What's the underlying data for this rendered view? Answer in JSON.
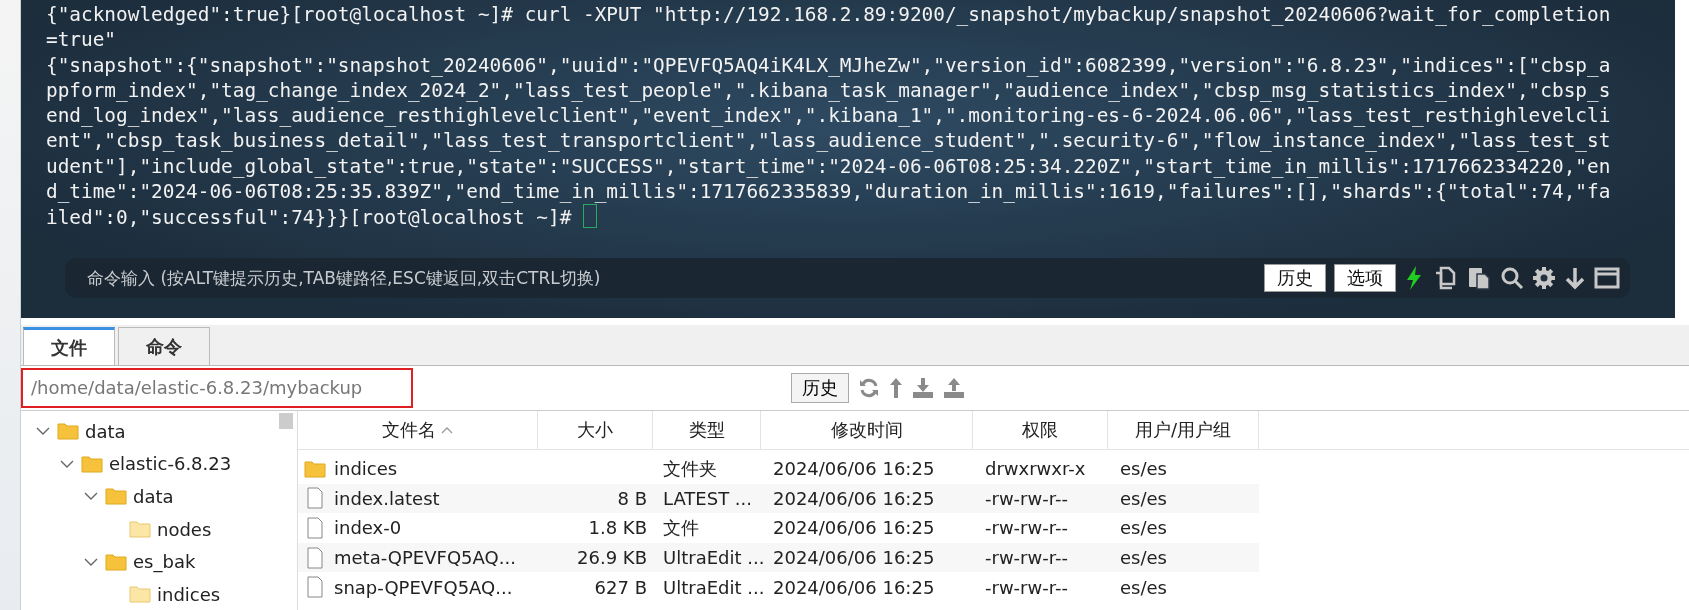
{
  "terminal": {
    "lines": [
      "{\"acknowledged\":true}[root@localhost ~]# curl -XPUT \"http://192.168.2.89:9200/_snapshot/mybackup/snapshot_20240606?wait_for_completion",
      "=true\"",
      "{\"snapshot\":{\"snapshot\":\"snapshot_20240606\",\"uuid\":\"QPEVFQ5AQ4iK4LX_MJheZw\",\"version_id\":6082399,\"version\":\"6.8.23\",\"indices\":[\"cbsp_a",
      "ppform_index\",\"tag_change_index_2024_2\",\"lass_test_people\",\".kibana_task_manager\",\"audience_index\",\"cbsp_msg_statistics_index\",\"cbsp_s",
      "end_log_index\",\"lass_audience_resthighlevelclient\",\"event_index\",\".kibana_1\",\".monitoring-es-6-2024.06.06\",\"lass_test_resthighlevelcli",
      "ent\",\"cbsp_task_business_detail\",\"lass_test_transportclient\",\"lass_audience_student\",\".security-6\",\"flow_instance_index\",\"lass_test_st",
      "udent\"],\"include_global_state\":true,\"state\":\"SUCCESS\",\"start_time\":\"2024-06-06T08:25:34.220Z\",\"start_time_in_millis\":1717662334220,\"en",
      "d_time\":\"2024-06-06T08:25:35.839Z\",\"end_time_in_millis\":1717662335839,\"duration_in_millis\":1619,\"failures\":[],\"shards\":{\"total\":74,\"fa",
      "iled\":0,\"successful\":74}}}[root@localhost ~]# "
    ],
    "cursor_visible": true
  },
  "command_bar": {
    "placeholder": "命令输入 (按ALT键提示历史,TAB键路径,ESC键返回,双击CTRL切换)",
    "buttons": [
      "历史",
      "选项"
    ]
  },
  "tabs": [
    {
      "label": "文件",
      "selected": true
    },
    {
      "label": "命令",
      "selected": false
    }
  ],
  "path_bar": {
    "value": "/home/data/elastic-6.8.23/mybackup",
    "highlighted": true,
    "history_button": "历史"
  },
  "tree": [
    {
      "label": "data",
      "expanded": true,
      "children": [
        {
          "label": "elastic-6.8.23",
          "expanded": true,
          "children": [
            {
              "label": "data",
              "expanded": true,
              "children": [
                {
                  "label": "nodes"
                }
              ]
            },
            {
              "label": "es_bak",
              "expanded": true,
              "children": [
                {
                  "label": "indices"
                }
              ]
            }
          ]
        }
      ]
    }
  ],
  "table": {
    "columns": [
      {
        "label": "文件名",
        "sorted": true
      },
      {
        "label": "大小",
        "sorted": false
      },
      {
        "label": "类型",
        "sorted": false
      },
      {
        "label": "修改时间",
        "sorted": false
      },
      {
        "label": "权限",
        "sorted": false
      },
      {
        "label": "用户/用户组",
        "sorted": false
      }
    ],
    "rows": [
      {
        "kind": "folder",
        "name": "indices",
        "size": "",
        "type": "文件夹",
        "modified": "2024/06/06 16:25",
        "permissions": "drwxrwxr-x",
        "owner": "es/es"
      },
      {
        "kind": "file",
        "name": "index.latest",
        "size": "8 B",
        "type": "LATEST ...",
        "modified": "2024/06/06 16:25",
        "permissions": "-rw-rw-r--",
        "owner": "es/es"
      },
      {
        "kind": "file",
        "name": "index-0",
        "size": "1.8 KB",
        "type": "文件",
        "modified": "2024/06/06 16:25",
        "permissions": "-rw-rw-r--",
        "owner": "es/es"
      },
      {
        "kind": "file",
        "name": "meta-QPEVFQ5AQ...",
        "size": "26.9 KB",
        "type": "UltraEdit ...",
        "modified": "2024/06/06 16:25",
        "permissions": "-rw-rw-r--",
        "owner": "es/es"
      },
      {
        "kind": "file",
        "name": "snap-QPEVFQ5AQ...",
        "size": "627 B",
        "type": "UltraEdit ...",
        "modified": "2024/06/06 16:25",
        "permissions": "-rw-rw-r--",
        "owner": "es/es"
      }
    ]
  }
}
